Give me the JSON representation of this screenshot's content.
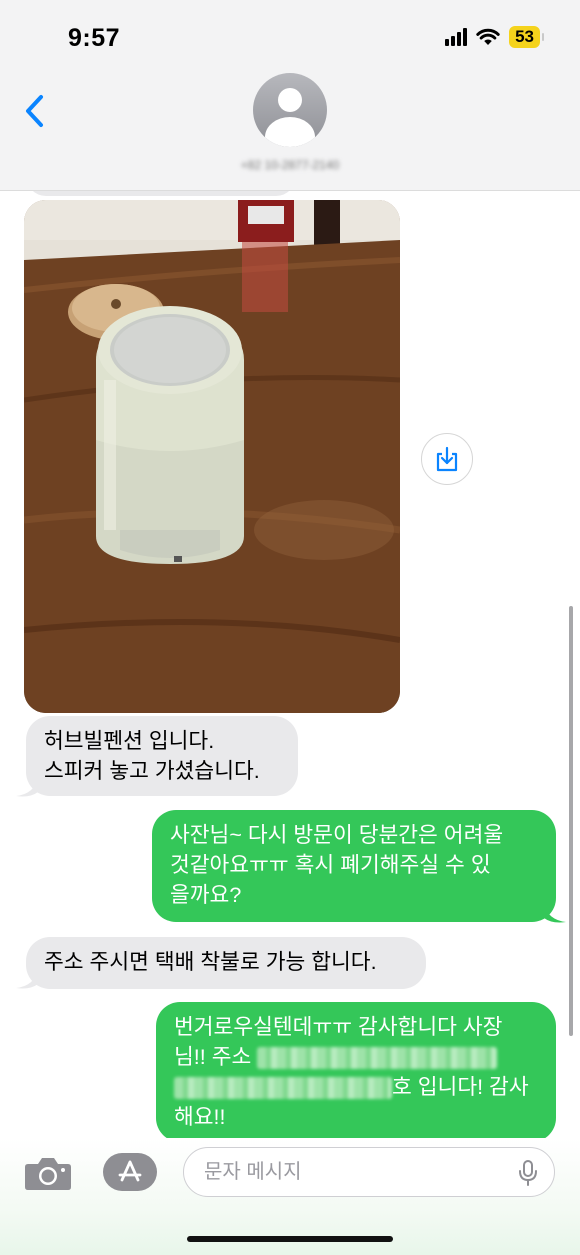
{
  "status_bar": {
    "time": "9:57",
    "battery": "53"
  },
  "header": {
    "contact_name": "+82 10-2877-2140"
  },
  "messages": [
    {
      "direction": "incoming",
      "text": "허브빌펜션 입니다.\n스피커 놓고 가셨습니다."
    },
    {
      "direction": "outgoing",
      "text": "사잔님~ 다시 방문이 당분간은 어려울\n것같아요ㅠㅠ 혹시 폐기해주실 수 있\n을까요?"
    },
    {
      "direction": "incoming",
      "text": "주소 주시면 택배 착불로 가능 합니다."
    },
    {
      "direction": "outgoing",
      "text_line1": "번거로우실텐데ㅠㅠ 감사합니다 사장",
      "text_line2": "님!! 주소",
      "text_line3_end": "호 입니다! 감사",
      "text_line4": "해요!!"
    }
  ],
  "composer": {
    "placeholder": "문자 메시지"
  },
  "colors": {
    "outgoing_bubble": "#34c759",
    "incoming_bubble": "#e9e9eb",
    "accent": "#0a84ff"
  },
  "icons": [
    "back-chevron-icon",
    "contact-avatar-icon",
    "save-photo-icon",
    "camera-icon",
    "app-store-icon",
    "microphone-icon"
  ]
}
